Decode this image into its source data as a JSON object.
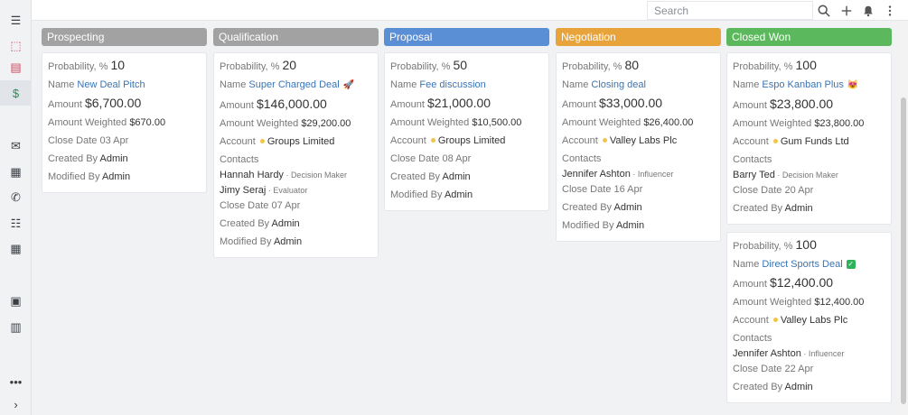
{
  "sidebar": {
    "items": [
      {
        "icon": "menu-icon",
        "glyph": "☰"
      },
      {
        "icon": "inbox-icon",
        "glyph": "⬚"
      },
      {
        "icon": "contact-card-icon",
        "glyph": "▤"
      },
      {
        "icon": "dollar-icon",
        "glyph": "$"
      },
      {
        "icon": "envelope-icon",
        "glyph": "✉"
      },
      {
        "icon": "calendar-check-icon",
        "glyph": "▦"
      },
      {
        "icon": "phone-icon",
        "glyph": "✆"
      },
      {
        "icon": "task-list-icon",
        "glyph": "☷"
      },
      {
        "icon": "calendar-icon",
        "glyph": "▦"
      },
      {
        "icon": "briefcase-icon",
        "glyph": "▣"
      },
      {
        "icon": "book-icon",
        "glyph": "▥"
      },
      {
        "icon": "more-icon",
        "glyph": "•••"
      },
      {
        "icon": "chevron-right-icon",
        "glyph": "›"
      }
    ]
  },
  "topbar": {
    "search_placeholder": "Search"
  },
  "labels": {
    "probability": "Probability, %",
    "name": "Name",
    "amount": "Amount",
    "amount_weighted": "Amount Weighted",
    "account": "Account",
    "contacts": "Contacts",
    "close_date": "Close Date",
    "created_by": "Created By",
    "modified_by": "Modified By"
  },
  "columns": [
    {
      "title": "Prospecting",
      "color": "#a2a2a2",
      "cards": [
        {
          "probability": "10",
          "name": "New Deal Pitch",
          "amount": "$6,700.00",
          "amount_weighted": "$670.00",
          "close_date": "03 Apr",
          "created_by": "Admin",
          "modified_by": "Admin"
        }
      ]
    },
    {
      "title": "Qualification",
      "color": "#a2a2a2",
      "cards": [
        {
          "probability": "20",
          "name": "Super Charged Deal",
          "emoji": "🚀",
          "amount": "$146,000.00",
          "amount_weighted": "$29,200.00",
          "account": "Groups Limited",
          "contacts": [
            {
              "name": "Hannah Hardy",
              "role": "Decision Maker"
            },
            {
              "name": "Jimy Seraj",
              "role": "Evaluator"
            }
          ],
          "close_date": "07 Apr",
          "created_by": "Admin",
          "modified_by": "Admin"
        }
      ]
    },
    {
      "title": "Proposal",
      "color": "#5a8fd6",
      "cards": [
        {
          "probability": "50",
          "name": "Fee discussion",
          "amount": "$21,000.00",
          "amount_weighted": "$10,500.00",
          "account": "Groups Limited",
          "close_date": "08 Apr",
          "created_by": "Admin",
          "modified_by": "Admin"
        }
      ]
    },
    {
      "title": "Negotiation",
      "color": "#e8a33a",
      "cards": [
        {
          "probability": "80",
          "name": "Closing deal",
          "amount": "$33,000.00",
          "amount_weighted": "$26,400.00",
          "account": "Valley Labs Plc",
          "contacts": [
            {
              "name": "Jennifer Ashton",
              "role": "Influencer"
            }
          ],
          "close_date": "16 Apr",
          "created_by": "Admin",
          "modified_by": "Admin"
        }
      ]
    },
    {
      "title": "Closed Won",
      "color": "#5cb85c",
      "cards": [
        {
          "probability": "100",
          "name": "Espo Kanban Plus",
          "emoji": "😻",
          "amount": "$23,800.00",
          "amount_weighted": "$23,800.00",
          "account": "Gum Funds Ltd",
          "contacts": [
            {
              "name": "Barry Ted",
              "role": "Decision Maker"
            }
          ],
          "close_date": "20 Apr",
          "created_by": "Admin"
        },
        {
          "probability": "100",
          "name": "Direct Sports Deal",
          "check": "✓",
          "amount": "$12,400.00",
          "amount_weighted": "$12,400.00",
          "account": "Valley Labs Plc",
          "contacts": [
            {
              "name": "Jennifer Ashton",
              "role": "Influencer"
            }
          ],
          "close_date": "22 Apr",
          "created_by": "Admin"
        }
      ]
    }
  ]
}
